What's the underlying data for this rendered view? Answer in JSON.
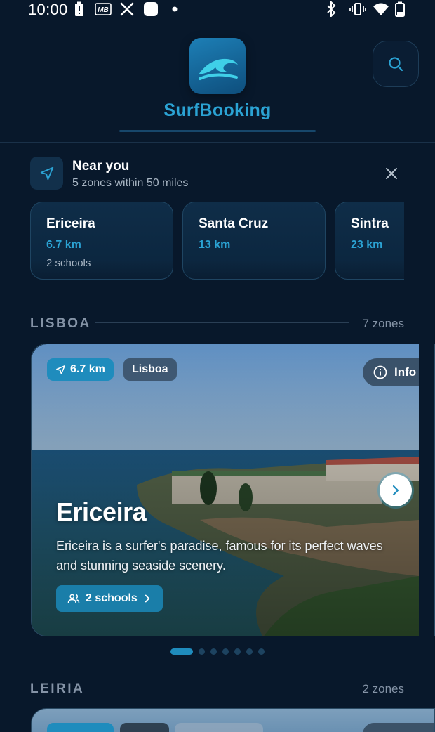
{
  "status_bar": {
    "time": "10:00",
    "icons": [
      "battery-saver-icon",
      "mb-icon",
      "x-icon",
      "square-icon",
      "dot-icon",
      "bluetooth-icon",
      "vibrate-icon",
      "wifi-icon",
      "battery-icon"
    ]
  },
  "header": {
    "app_name": "SurfBooking",
    "logo_icon": "wave-icon",
    "search_icon": "search-icon"
  },
  "near_you": {
    "title": "Near you",
    "subtitle": "5 zones within 50 miles",
    "zones": [
      {
        "name": "Ericeira",
        "distance": "6.7 km",
        "schools": "2 schools"
      },
      {
        "name": "Santa Cruz",
        "distance": "13 km",
        "schools": ""
      },
      {
        "name": "Sintra",
        "distance": "23 km",
        "schools": ""
      }
    ]
  },
  "sections": [
    {
      "name": "LISBOA",
      "count": "7 zones",
      "card": {
        "distance": "6.7 km",
        "region": "Lisboa",
        "info_label": "Info",
        "title": "Ericeira",
        "description": "Ericeira is a surfer's paradise, famous for its perfect waves and stunning seaside scenery.",
        "schools_label": "2 schools"
      },
      "pagination": {
        "total": 7,
        "active": 0
      }
    },
    {
      "name": "LEIRIA",
      "count": "2 zones"
    }
  ],
  "colors": {
    "background": "#08182b",
    "accent": "#2ba3d4",
    "card_border": "#1f4562"
  }
}
